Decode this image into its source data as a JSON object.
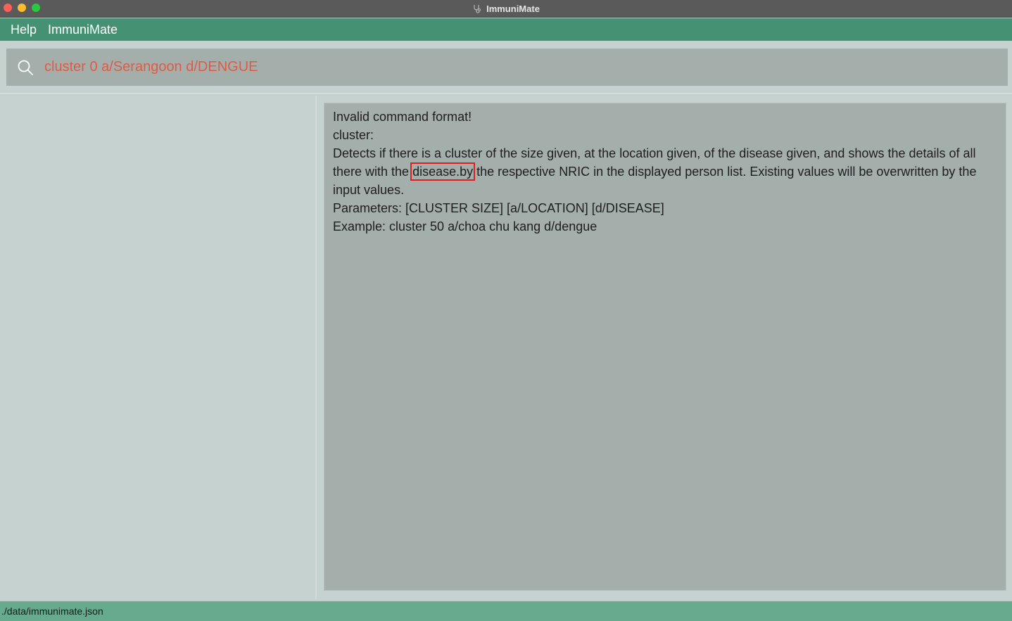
{
  "window": {
    "title": "ImmuniMate"
  },
  "menu": {
    "items": [
      "Help",
      "ImmuniMate"
    ]
  },
  "command": {
    "value": "cluster 0 a/Serangoon d/DENGUE"
  },
  "result": {
    "line1": "Invalid command format!",
    "line2": "cluster:",
    "desc_before": "Detects if there is a cluster of the size given, at the location given, of the disease given, and shows the details of all there with the ",
    "desc_highlight": "disease.by",
    "desc_after": " the respective NRIC in the displayed person list. Existing values will be overwritten by the input values.",
    "params": "Parameters: [CLUSTER SIZE] [a/LOCATION] [d/DISEASE]",
    "example": "Example: cluster 50 a/choa chu kang d/dengue"
  },
  "status": {
    "path": "./data/immunimate.json"
  },
  "icons": {
    "app": "stethoscope-icon",
    "search": "search-icon"
  },
  "colors": {
    "menu": "#449173",
    "status": "#66ab8d",
    "command_text": "#e05a45",
    "highlight_box": "#e02020"
  }
}
